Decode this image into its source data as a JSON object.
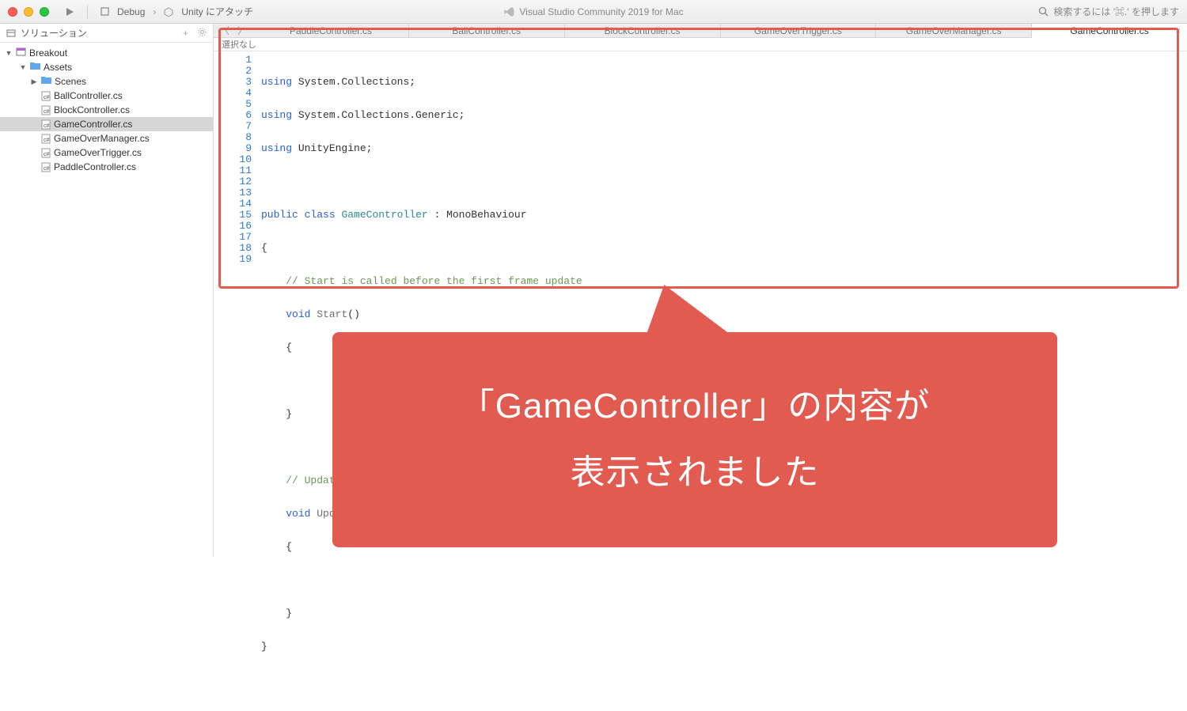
{
  "titlebar": {
    "debug_label": "Debug",
    "attach_label": "Unity にアタッチ",
    "app_title": "Visual Studio Community 2019 for Mac",
    "search_hint": "検索するには '⌘.' を押します"
  },
  "sidebar": {
    "panel_title": "ソリューション",
    "tree": {
      "root": "Breakout",
      "assets": "Assets",
      "scenes": "Scenes",
      "files": [
        "BallController.cs",
        "BlockController.cs",
        "GameController.cs",
        "GameOverManager.cs",
        "GameOverTrigger.cs",
        "PaddleController.cs"
      ],
      "selected_index": 2
    }
  },
  "tabs": {
    "items": [
      "PaddleController.cs",
      "BallController.cs",
      "BlockController.cs",
      "GameOverTrigger.cs",
      "GameOverManager.cs",
      "GameController.cs"
    ],
    "active_index": 5
  },
  "breadcrumb": "選択なし",
  "code": {
    "line_count": 19,
    "tokens": {
      "using": "using",
      "public": "public",
      "class": "class",
      "void": "void",
      "ns1": " System.Collections;",
      "ns2": " System.Collections.Generic;",
      "ns3": " UnityEngine;",
      "classname": "GameController",
      "inherit": " : MonoBehaviour",
      "cmt1": "// Start is called before the first frame update",
      "cmt2": "// Update is called once per frame",
      "m_start": "Start",
      "m_update": "Update",
      "parens": "()",
      "obrace": "{",
      "cbrace": "}"
    }
  },
  "callout": {
    "line1": "「GameController」の内容が",
    "line2": "表示されました"
  }
}
